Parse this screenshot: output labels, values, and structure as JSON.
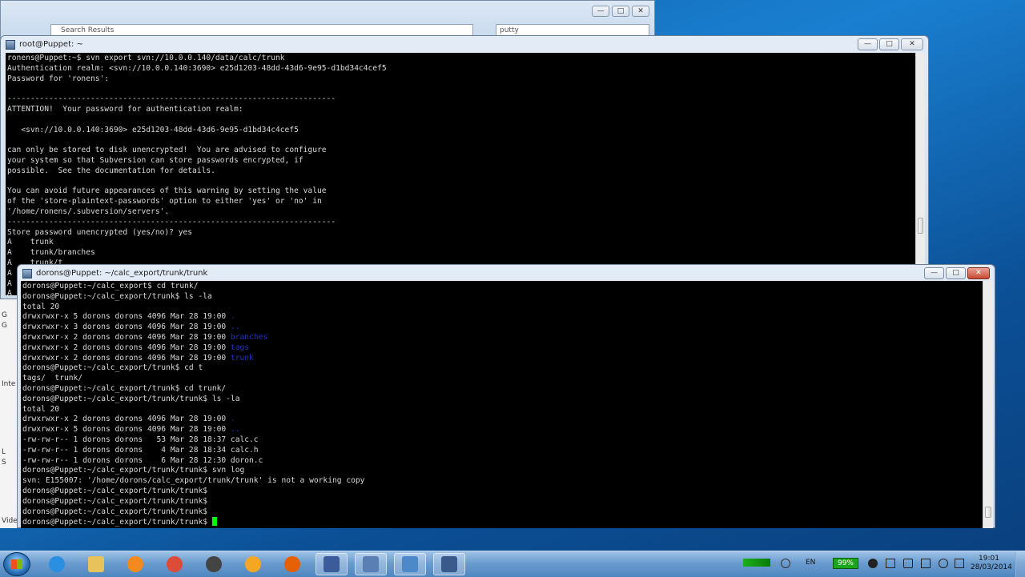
{
  "explorer": {
    "address_text": "Search Results",
    "search_text": "putty"
  },
  "left_strip": [
    "G",
    "G",
    "Inte",
    "L",
    "S",
    "Vide"
  ],
  "window1": {
    "title": "root@Puppet: ~",
    "lines": [
      "ronens@Puppet:~$ svn export svn://10.0.0.140/data/calc/trunk",
      "Authentication realm: <svn://10.0.0.140:3690> e25d1203-48dd-43d6-9e95-d1bd34c4cef5",
      "Password for 'ronens':",
      "",
      "-----------------------------------------------------------------------",
      "ATTENTION!  Your password for authentication realm:",
      "",
      "   <svn://10.0.0.140:3690> e25d1203-48dd-43d6-9e95-d1bd34c4cef5",
      "",
      "can only be stored to disk unencrypted!  You are advised to configure",
      "your system so that Subversion can store passwords encrypted, if",
      "possible.  See the documentation for details.",
      "",
      "You can avoid future appearances of this warning by setting the value",
      "of the 'store-plaintext-passwords' option to either 'yes' or 'no' in",
      "'/home/ronens/.subversion/servers'.",
      "-----------------------------------------------------------------------",
      "Store password unencrypted (yes/no)? yes",
      "A    trunk",
      "A    trunk/branches",
      "A    trunk/t",
      "A",
      "A",
      "A"
    ]
  },
  "window2": {
    "title": "dorons@Puppet: ~/calc_export/trunk/trunk",
    "lines": [
      {
        "t": "dorons@Puppet:~/calc_export$ cd trunk/"
      },
      {
        "t": "dorons@Puppet:~/calc_export/trunk$ ls -la"
      },
      {
        "t": "total 20"
      },
      {
        "t": "drwxrwxr-x 5 dorons dorons 4096 Mar 28 19:00 ",
        "b": "."
      },
      {
        "t": "drwxrwxr-x 3 dorons dorons 4096 Mar 28 19:00 ",
        "b": ".."
      },
      {
        "t": "drwxrwxr-x 2 dorons dorons 4096 Mar 28 19:00 ",
        "b": "branches"
      },
      {
        "t": "drwxrwxr-x 2 dorons dorons 4096 Mar 28 19:00 ",
        "b": "tags"
      },
      {
        "t": "drwxrwxr-x 2 dorons dorons 4096 Mar 28 19:00 ",
        "b": "trunk"
      },
      {
        "t": "dorons@Puppet:~/calc_export/trunk$ cd t"
      },
      {
        "t": "tags/  trunk/"
      },
      {
        "t": "dorons@Puppet:~/calc_export/trunk$ cd trunk/"
      },
      {
        "t": "dorons@Puppet:~/calc_export/trunk/trunk$ ls -la"
      },
      {
        "t": "total 20"
      },
      {
        "t": "drwxrwxr-x 2 dorons dorons 4096 Mar 28 19:00 ",
        "b": "."
      },
      {
        "t": "drwxrwxr-x 5 dorons dorons 4096 Mar 28 19:00 ",
        "b": ".."
      },
      {
        "t": "-rw-rw-r-- 1 dorons dorons   53 Mar 28 18:37 calc.c"
      },
      {
        "t": "-rw-rw-r-- 1 dorons dorons    4 Mar 28 18:34 calc.h"
      },
      {
        "t": "-rw-rw-r-- 1 dorons dorons    6 Mar 28 12:30 doron.c"
      },
      {
        "t": "dorons@Puppet:~/calc_export/trunk/trunk$ svn log"
      },
      {
        "t": "svn: E155007: '/home/dorons/calc_export/trunk/trunk' is not a working copy"
      },
      {
        "t": "dorons@Puppet:~/calc_export/trunk/trunk$"
      },
      {
        "t": "dorons@Puppet:~/calc_export/trunk/trunk$"
      },
      {
        "t": "dorons@Puppet:~/calc_export/trunk/trunk$"
      },
      {
        "t": "dorons@Puppet:~/calc_export/trunk/trunk$ ",
        "cursor": true
      }
    ]
  },
  "window_buttons": {
    "minimize": "—",
    "maximize": "□",
    "close": "✕"
  },
  "taskbar": {
    "apps": [
      {
        "name": "ie-icon",
        "color": "#2a8fe0"
      },
      {
        "name": "explorer-folder-icon",
        "color": "#e8c25a"
      },
      {
        "name": "media-player-icon",
        "color": "#f28a1e"
      },
      {
        "name": "chrome-icon",
        "color": "#dd4b39"
      },
      {
        "name": "disc-burner-icon",
        "color": "#444444"
      },
      {
        "name": "vlc-like-icon",
        "color": "#f5a623"
      },
      {
        "name": "firefox-icon",
        "color": "#e66000"
      },
      {
        "name": "virtualbox-icon",
        "color": "#3b5b9a"
      },
      {
        "name": "file-manager-icon",
        "color": "#5a7fb5"
      },
      {
        "name": "remote-desktop-icon",
        "color": "#4d88c9"
      },
      {
        "name": "putty-icon",
        "color": "#3a5a8c"
      }
    ],
    "language": "EN",
    "battery": "99%",
    "time": "19:01",
    "date": "28/03/2014"
  }
}
